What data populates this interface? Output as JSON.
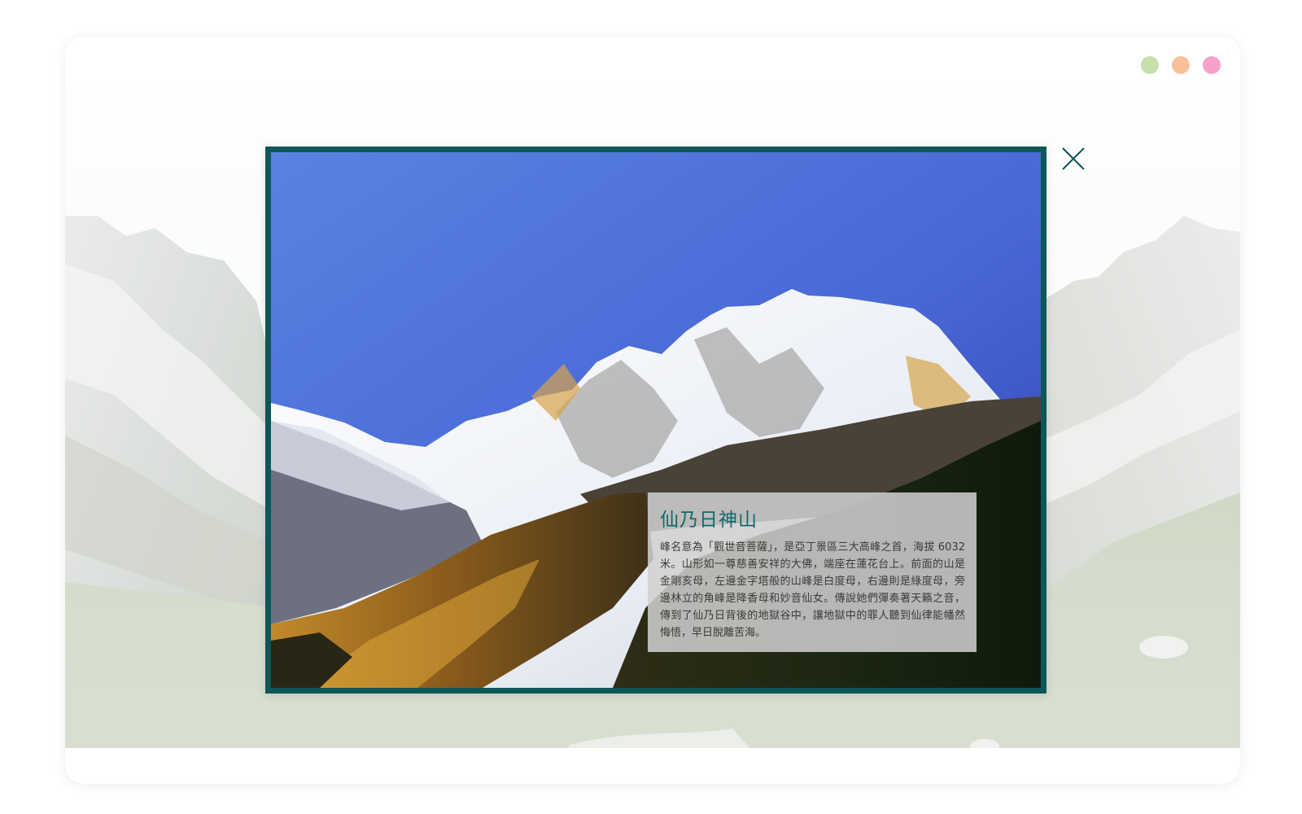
{
  "window": {
    "controls": [
      {
        "name": "green",
        "color": "#c6dfa9"
      },
      {
        "name": "orange",
        "color": "#f8c19a"
      },
      {
        "name": "pink",
        "color": "#f4a2c9"
      }
    ]
  },
  "lightbox": {
    "close_icon": "close-icon",
    "accent_color": "#0e5758",
    "caption": {
      "title": "仙乃日神山",
      "body": "峰名意為「觀世音菩薩」，是亞丁景區三大高峰之首，海拔 6032 米。山形如一尊慈善安祥的大佛，端座在蓮花台上。前面的山是金剛亥母，左邊金字塔般的山峰是白度母，右邊則是綠度母，旁邊林立的角峰是降香母和妙音仙女。傳說她們彈奏著天籟之音，傳到了仙乃日背後的地獄谷中，讓地獄中的罪人聽到仙律能幡然悔悟，早日脫離苦海。"
    }
  }
}
